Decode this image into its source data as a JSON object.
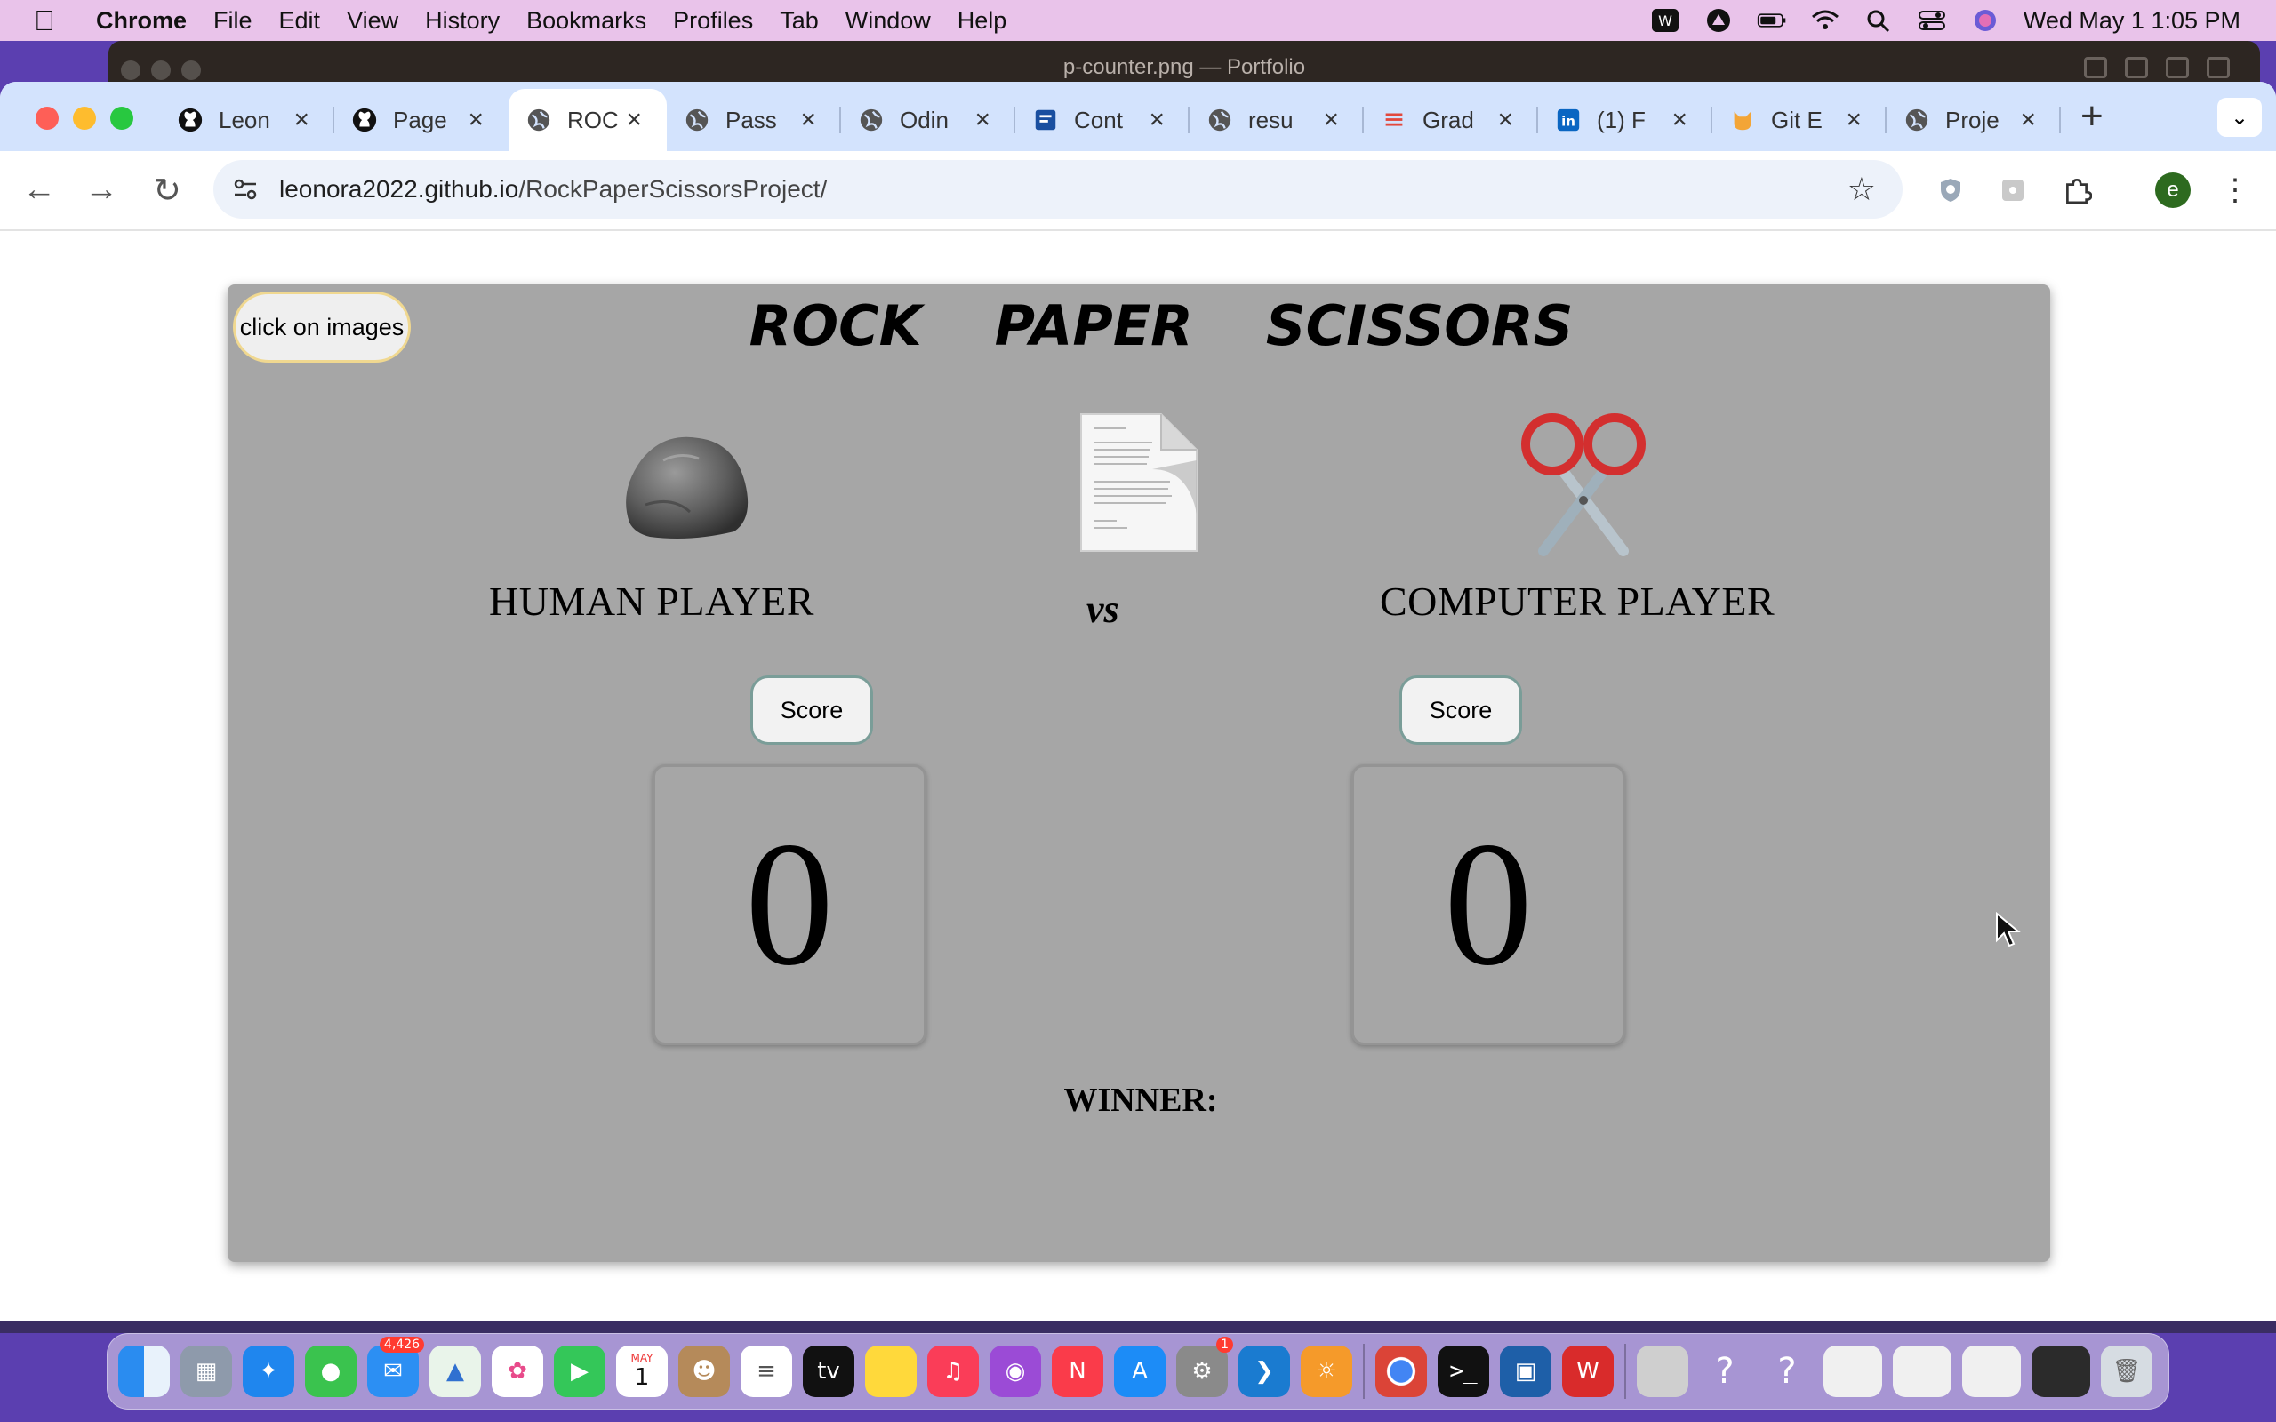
{
  "menubar": {
    "app": "Chrome",
    "items": [
      "File",
      "Edit",
      "View",
      "History",
      "Bookmarks",
      "Profiles",
      "Tab",
      "Window",
      "Help"
    ],
    "clock": "Wed May 1  1:05 PM"
  },
  "background_window": {
    "title": "p-counter.png — Portfolio"
  },
  "tabs": [
    {
      "label": "Leon",
      "icon": "github-icon"
    },
    {
      "label": "Page",
      "icon": "github-icon"
    },
    {
      "label": "ROC",
      "icon": "globe-icon",
      "active": true
    },
    {
      "label": "Pass",
      "icon": "globe-icon"
    },
    {
      "label": "Odin",
      "icon": "globe-icon"
    },
    {
      "label": "Cont",
      "icon": "doc-icon"
    },
    {
      "label": "resu",
      "icon": "globe-icon"
    },
    {
      "label": "Grad",
      "icon": "list-icon"
    },
    {
      "label": "(1) F",
      "icon": "linkedin-icon"
    },
    {
      "label": "Git E",
      "icon": "cat-icon"
    },
    {
      "label": "Proje",
      "icon": "globe-icon"
    }
  ],
  "address_bar": {
    "host": "leonora2022.github.io",
    "path": "/RockPaperScissorsProject/"
  },
  "profile_initial": "e",
  "game": {
    "hint_button": "click on images",
    "title_words": [
      "ROCK",
      "PAPER",
      "SCISSORS"
    ],
    "human_label": "HUMAN PLAYER",
    "computer_label": "COMPUTER PLAYER",
    "vs": "vs",
    "human_score_button": "Score",
    "computer_score_button": "Score",
    "human_score": "0",
    "computer_score": "0",
    "winner_label": "WINNER:"
  },
  "dock": {
    "mail_badge": "4,426",
    "calendar_month": "MAY",
    "calendar_day": "1",
    "settings_badge": "1"
  }
}
